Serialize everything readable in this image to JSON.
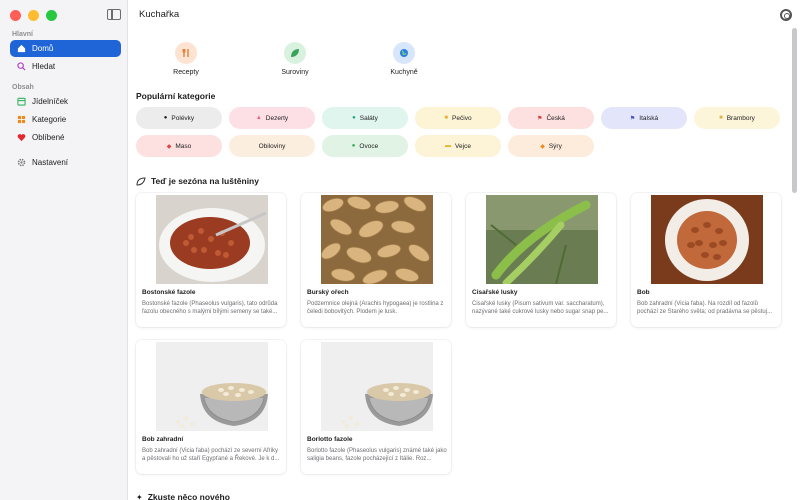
{
  "app": {
    "title": "Kuchařka"
  },
  "sidebar": {
    "section_main": "Hlavní",
    "section_content": "Obsah",
    "items": [
      {
        "label": "Domů",
        "icon": "house-icon"
      },
      {
        "label": "Hledat",
        "icon": "search-icon"
      },
      {
        "label": "Jídelníček",
        "icon": "calendar-icon"
      },
      {
        "label": "Kategorie",
        "icon": "grid-icon"
      },
      {
        "label": "Oblíbené",
        "icon": "heart-icon"
      },
      {
        "label": "Nastavení",
        "icon": "gear-icon"
      }
    ],
    "accent": "#2065d8"
  },
  "top_categories": [
    {
      "label": "Recepty",
      "icon": "fork-knife-icon",
      "color": "#fde3d2"
    },
    {
      "label": "Suroviny",
      "icon": "leaf-icon",
      "color": "#d9f1df"
    },
    {
      "label": "Kuchyně",
      "icon": "globe-icon",
      "color": "#d7e6fb"
    }
  ],
  "popular": {
    "heading": "Populární kategorie",
    "chips": [
      {
        "label": "Polévky",
        "color": "#ececec"
      },
      {
        "label": "Dezerty",
        "color": "#fce0e6"
      },
      {
        "label": "Saláty",
        "color": "#dff5ee"
      },
      {
        "label": "Pečivo",
        "color": "#fdf4d6"
      },
      {
        "label": "Česká",
        "color": "#fde0e0"
      },
      {
        "label": "Italská",
        "color": "#e3e6fb"
      },
      {
        "label": "Brambory",
        "color": "#fdf5da"
      },
      {
        "label": "Maso",
        "color": "#fde1e1"
      },
      {
        "label": "Obiloviny",
        "color": "#fbeede"
      },
      {
        "label": "Ovoce",
        "color": "#e0f3e4"
      },
      {
        "label": "Vejce",
        "color": "#fdf3d6"
      },
      {
        "label": "Sýry",
        "color": "#fdecdc"
      }
    ]
  },
  "season": {
    "heading": "Teď je sezóna na luštěniny",
    "cards": [
      {
        "title": "Bostonské fazole",
        "desc": "Bostonské fazole (Phaseolus vulgaris), tato odrůda fazolu obecného s malými bílými semeny se také..."
      },
      {
        "title": "Burský ořech",
        "desc": "Podzemnice olejná (Arachis hypogaea) je rostlina z čeledi bobovitých. Plodem je lusk."
      },
      {
        "title": "Cisařské lusky",
        "desc": "Cisařské lusky (Pisum sativum var. saccharatum), nazývané také cukrové lusky nebo sugar snap pe..."
      },
      {
        "title": "Bob",
        "desc": "Bob zahradní (Vicia faba). Na rozdíl od fazolů pochází ze Starého světa; od pradávna se pěstuj..."
      },
      {
        "title": "Bob zahradní",
        "desc": "Bob zahradní (Vicia faba) pochází ze severní Afriky a pěstovali ho už staří Egypťané a Řekové. Je k d..."
      },
      {
        "title": "Borlotto fazole",
        "desc": "Borlotto fazole (Phaseolus vulgaris) známé také jako saligia beans, fazole pocházející z Itálie. Roz..."
      }
    ]
  },
  "try_new": {
    "heading": "Zkuste něco nového"
  }
}
